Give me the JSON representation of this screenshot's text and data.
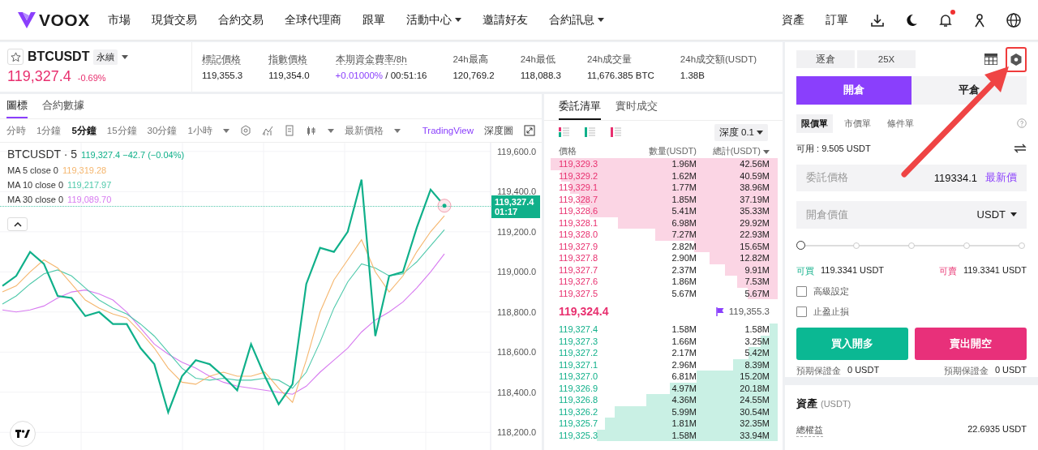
{
  "nav": {
    "brand": "VOOX",
    "items": [
      {
        "label": "市場",
        "dropdown": false
      },
      {
        "label": "現貨交易",
        "dropdown": false
      },
      {
        "label": "合約交易",
        "dropdown": false
      },
      {
        "label": "全球代理商",
        "dropdown": false
      },
      {
        "label": "跟單",
        "dropdown": false
      },
      {
        "label": "活動中心",
        "dropdown": true
      },
      {
        "label": "邀請好友",
        "dropdown": false
      },
      {
        "label": "合約訊息",
        "dropdown": true
      }
    ],
    "right_items": [
      "資產",
      "訂單"
    ],
    "unread_notifications": true
  },
  "ticker": {
    "symbol": "BTCUSDT",
    "favorite": false,
    "contract_type": "永續",
    "price": "119,327.4",
    "change": "-0.69%",
    "stats": [
      {
        "label": "標記價格",
        "value": "119,355.3",
        "underlined": true
      },
      {
        "label": "指數價格",
        "value": "119,354.0",
        "underlined": true
      },
      {
        "label": "本期資金費率/8h",
        "highlight": "+0.01000%",
        "value": "/ 00:51:16",
        "underlined": true
      },
      {
        "label": "24h最高",
        "value": "120,769.2",
        "underlined": false
      },
      {
        "label": "24h最低",
        "value": "118,088.3",
        "underlined": false
      },
      {
        "label": "24h成交量",
        "value": "11,676.385 BTC",
        "underlined": false
      },
      {
        "label": "24h成交額(USDT)",
        "value": "1.38B",
        "underlined": false
      }
    ]
  },
  "chart_panel": {
    "tabs": [
      {
        "label": "圖標",
        "selected": true
      },
      {
        "label": "合約數據",
        "selected": false
      }
    ],
    "intervals": [
      {
        "label": "分時",
        "selected": false
      },
      {
        "label": "1分鐘",
        "selected": false
      },
      {
        "label": "5分鐘",
        "selected": true
      },
      {
        "label": "15分鐘",
        "selected": false
      },
      {
        "label": "30分鐘",
        "selected": false
      },
      {
        "label": "1小時",
        "selected": false
      }
    ],
    "price_source": "最新價格",
    "views": [
      {
        "label": "TradingView",
        "selected": true
      },
      {
        "label": "深度圖",
        "selected": false
      }
    ],
    "legend": {
      "quote": "119,327.4 −42.7 (−0.04%)",
      "ma_values": [
        "119,319.28",
        "119,217.97",
        "119,089.70"
      ]
    },
    "last_price_tag": {
      "price": "119,327.4",
      "countdown": "01:17"
    },
    "chart_data": {
      "type": "line",
      "grid": true,
      "ylim": [
        118104,
        119644
      ],
      "yticks": [
        {
          "value": 118200,
          "label": "118,200.0"
        },
        {
          "value": 118400,
          "label": "118,400.0"
        },
        {
          "value": 118600,
          "label": "118,600.0"
        },
        {
          "value": 118800,
          "label": "118,800.0"
        },
        {
          "value": 119000,
          "label": "119,000.0"
        },
        {
          "value": 119200,
          "label": "119,200.0"
        },
        {
          "value": 119400,
          "label": "119,400.0"
        },
        {
          "value": 119600,
          "label": "119,600.0"
        }
      ],
      "series": [
        {
          "name": "BTCUSDT · 5",
          "color": "#10b08a",
          "values": [
            118930,
            118980,
            119100,
            119040,
            118880,
            118870,
            118780,
            118800,
            118740,
            118740,
            118620,
            118540,
            118300,
            118480,
            118560,
            118540,
            118480,
            118410,
            118640,
            118480,
            118340,
            118440,
            118940,
            119120,
            119100,
            119200,
            119460,
            118680,
            118980,
            119000,
            119220,
            119410,
            119330
          ]
        },
        {
          "name": "MA 5 close 0",
          "color": "#f5b66e",
          "values": [
            118900,
            118930,
            119000,
            119060,
            119020,
            118940,
            118860,
            118820,
            118790,
            118770,
            118700,
            118620,
            118520,
            118450,
            118440,
            118480,
            118500,
            118480,
            118480,
            118500,
            118420,
            118350,
            118560,
            118800,
            118960,
            119060,
            119160,
            119000,
            118900,
            118980,
            119100,
            119200,
            119280
          ]
        },
        {
          "name": "MA 10 close 0",
          "color": "#4fc9ab",
          "values": [
            118840,
            118880,
            118940,
            118990,
            119010,
            118980,
            118920,
            118860,
            118820,
            118790,
            118740,
            118680,
            118600,
            118520,
            118470,
            118460,
            118470,
            118460,
            118460,
            118470,
            118460,
            118420,
            118500,
            118650,
            118820,
            118950,
            119040,
            119020,
            118980,
            118990,
            119050,
            119130,
            119210
          ]
        },
        {
          "name": "MA 30 close 0",
          "color": "#d77af0",
          "values": [
            118810,
            118800,
            118810,
            118830,
            118870,
            118900,
            118910,
            118890,
            118860,
            118800,
            118720,
            118640,
            118590,
            118550,
            118520,
            118480,
            118450,
            118430,
            118420,
            118410,
            118400,
            118390,
            118430,
            118500,
            118560,
            118620,
            118700,
            118760,
            118800,
            118850,
            118920,
            119000,
            119090
          ]
        }
      ]
    }
  },
  "order_book": {
    "tabs": [
      {
        "label": "委託清單",
        "selected": true
      },
      {
        "label": "實时成交",
        "selected": false
      }
    ],
    "depth": "深度 0.1",
    "columns": [
      "價格",
      "數量(USDT)",
      "總計(USDT)"
    ],
    "asks": [
      {
        "price": "119,329.3",
        "amount": "1.96M",
        "total": "42.56M"
      },
      {
        "price": "119,329.2",
        "amount": "1.62M",
        "total": "40.59M"
      },
      {
        "price": "119,329.1",
        "amount": "1.77M",
        "total": "38.96M"
      },
      {
        "price": "119,328.7",
        "amount": "1.85M",
        "total": "37.19M"
      },
      {
        "price": "119,328.6",
        "amount": "5.41M",
        "total": "35.33M"
      },
      {
        "price": "119,328.1",
        "amount": "6.98M",
        "total": "29.92M"
      },
      {
        "price": "119,328.0",
        "amount": "7.27M",
        "total": "22.93M"
      },
      {
        "price": "119,327.9",
        "amount": "2.82M",
        "total": "15.65M"
      },
      {
        "price": "119,327.8",
        "amount": "2.90M",
        "total": "12.82M"
      },
      {
        "price": "119,327.7",
        "amount": "2.37M",
        "total": "9.91M"
      },
      {
        "price": "119,327.6",
        "amount": "1.86M",
        "total": "7.53M"
      },
      {
        "price": "119,327.5",
        "amount": "5.67M",
        "total": "5.67M"
      }
    ],
    "last_price": "119,324.4",
    "mark_price": "119,355.3",
    "bids": [
      {
        "price": "119,327.4",
        "amount": "1.58M",
        "total": "1.58M"
      },
      {
        "price": "119,327.3",
        "amount": "1.66M",
        "total": "3.25M"
      },
      {
        "price": "119,327.2",
        "amount": "2.17M",
        "total": "5.42M"
      },
      {
        "price": "119,327.1",
        "amount": "2.96M",
        "total": "8.39M"
      },
      {
        "price": "119,327.0",
        "amount": "6.81M",
        "total": "15.20M"
      },
      {
        "price": "119,326.9",
        "amount": "4.97M",
        "total": "20.18M"
      },
      {
        "price": "119,326.8",
        "amount": "4.36M",
        "total": "24.55M"
      },
      {
        "price": "119,326.2",
        "amount": "5.99M",
        "total": "30.54M"
      },
      {
        "price": "119,325.7",
        "amount": "1.81M",
        "total": "32.35M"
      },
      {
        "price": "119,325.3",
        "amount": "1.58M",
        "total": "33.94M"
      }
    ]
  },
  "order_form": {
    "margin_mode": "逐倉",
    "leverage": "25X",
    "sides": [
      {
        "label": "開倉",
        "selected": true
      },
      {
        "label": "平倉",
        "selected": false
      }
    ],
    "order_types": [
      {
        "label": "限價單",
        "selected": true
      },
      {
        "label": "市價單",
        "selected": false
      },
      {
        "label": "條件單",
        "selected": false
      }
    ],
    "available": "可用 : 9.505 USDT",
    "price_field": {
      "label": "委託價格",
      "value": "119334.1",
      "action": "最新價"
    },
    "value_field": {
      "label": "開倉價值",
      "unit": "USDT"
    },
    "slider": {
      "level": 0
    },
    "can_buy_label": "可買",
    "can_buy": "119.3341 USDT",
    "can_sell_label": "可賣",
    "can_sell": "119.3341 USDT",
    "options": [
      {
        "label": "高級設定",
        "checked": false
      },
      {
        "label": "止盈止損",
        "checked": false
      }
    ],
    "buy_button": "買入開多",
    "sell_button": "賣出開空",
    "margins": [
      {
        "label": "預期保證金",
        "value": "0 USDT"
      },
      {
        "label": "預期保證金",
        "value": "0 USDT"
      }
    ]
  },
  "assets": {
    "title": "資產",
    "unit": "(USDT)",
    "rows": [
      {
        "label": "總權益",
        "value": "22.6935 USDT"
      }
    ]
  }
}
